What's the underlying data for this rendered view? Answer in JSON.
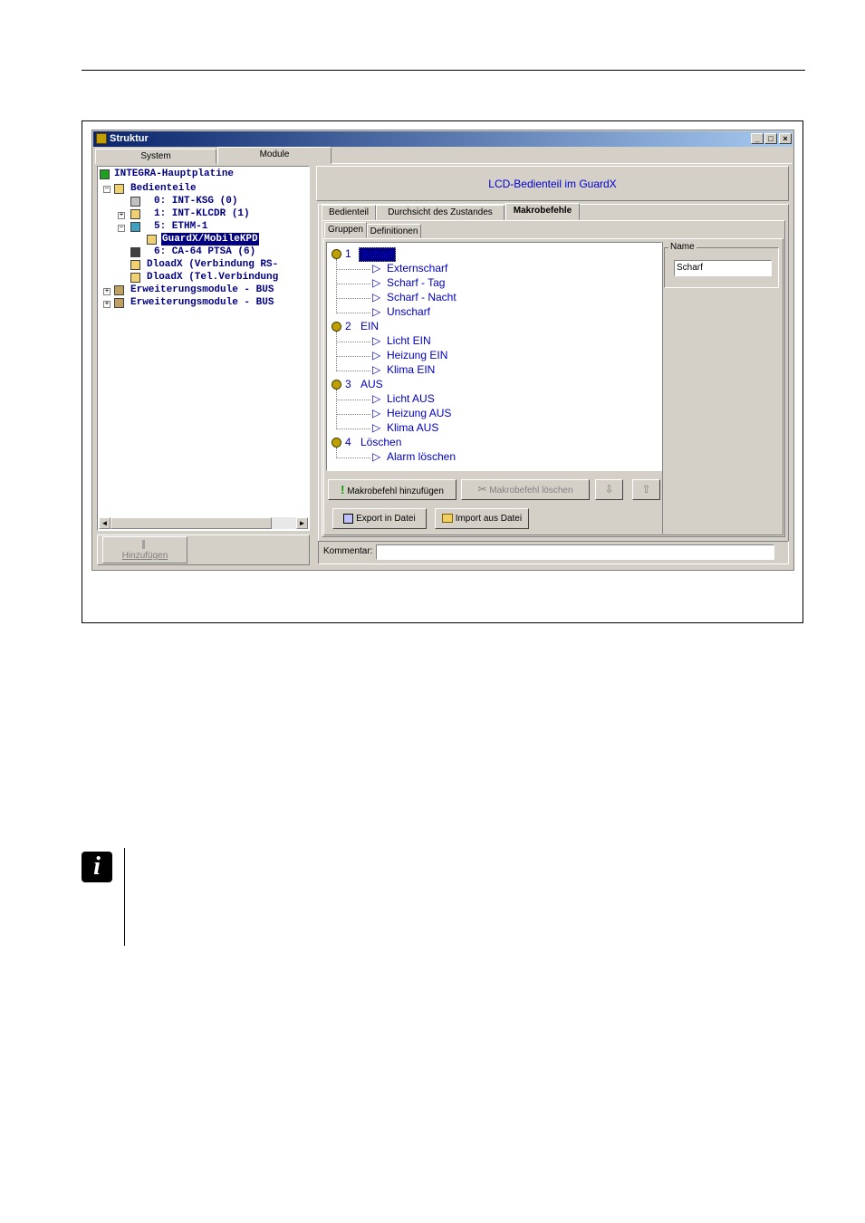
{
  "window": {
    "title": "Struktur",
    "controls": {
      "minimize": "_",
      "maximize": "□",
      "close": "×"
    }
  },
  "main_tabs": [
    {
      "label": "System"
    },
    {
      "label": "Module"
    }
  ],
  "tree": {
    "items": [
      {
        "label": "INTEGRA-Hauptplatine"
      },
      {
        "label": "Bedienteile"
      },
      {
        "label": "0: INT-KSG     (0)"
      },
      {
        "label": "1: INT-KLCDR   (1)"
      },
      {
        "label": "5: ETHM-1"
      },
      {
        "label": "GuardX/MobileKPD"
      },
      {
        "label": "6: CA-64 PTSA  (6)"
      },
      {
        "label": "DloadX (Verbindung RS-"
      },
      {
        "label": "DloadX (Tel.Verbindung"
      },
      {
        "label": "Erweiterungsmodule - BUS"
      },
      {
        "label": "Erweiterungsmodule - BUS"
      }
    ],
    "add_button": "Hinzufügen"
  },
  "header": {
    "title": "LCD-Bedienteil im GuardX"
  },
  "sub_tabs": [
    {
      "label": "Bedienteil"
    },
    {
      "label": "Durchsicht des Zustandes"
    },
    {
      "label": "Makrobefehle"
    }
  ],
  "inner_tabs": [
    {
      "label": "Gruppen"
    },
    {
      "label": "Definitionen"
    }
  ],
  "groups": [
    {
      "num": "1",
      "name": "Scharf",
      "macros": [
        "Externscharf",
        "Scharf - Tag",
        "Scharf - Nacht",
        "Unscharf"
      ]
    },
    {
      "num": "2",
      "name": "EIN",
      "macros": [
        "Licht EIN",
        "Heizung EIN",
        "Klima EIN"
      ]
    },
    {
      "num": "3",
      "name": "AUS",
      "macros": [
        "Licht AUS",
        "Heizung AUS",
        "Klima AUS"
      ]
    },
    {
      "num": "4",
      "name": "Löschen",
      "macros": [
        "Alarm löschen"
      ]
    }
  ],
  "name_box": {
    "label": "Name",
    "value": "Scharf"
  },
  "buttons": {
    "add_macro": "Makrobefehl hinzufügen",
    "delete_macro": "Makrobefehl löschen",
    "down": "⇩",
    "up": "⇧",
    "export": "Export in Datei",
    "import": "Import aus Datei"
  },
  "comment": {
    "label": "Kommentar:",
    "value": ""
  }
}
